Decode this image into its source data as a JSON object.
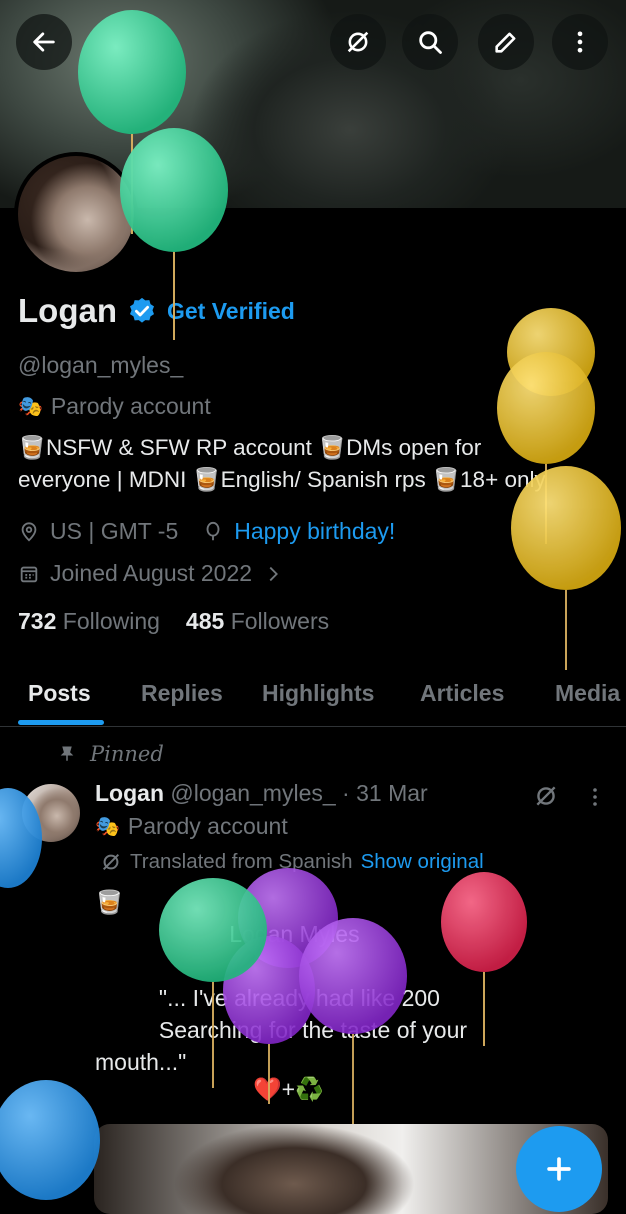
{
  "header": {
    "back_icon": "arrow-left-icon",
    "actions": [
      "grok-icon",
      "search-icon",
      "edit-icon",
      "more-vertical-icon"
    ]
  },
  "profile": {
    "name": "Logan",
    "verify_link": "Get Verified",
    "handle": "@logan_myles_",
    "parody_label": "Parody account",
    "bio_line1": "🥃NSFW & SFW RP account  🥃DMs open for",
    "bio_line2": "everyone | MDNI 🥃English/ Spanish rps 🥃18+ only",
    "location": "US | GMT -5",
    "birthday": "Happy birthday!",
    "joined": "Joined August 2022",
    "following_count": "732",
    "following_label": "Following",
    "followers_count": "485",
    "followers_label": "Followers"
  },
  "tabs": [
    "Posts",
    "Replies",
    "Highlights",
    "Articles",
    "Media"
  ],
  "post": {
    "pinned_label": "Pinned",
    "author": "Logan",
    "meta": "@logan_myles_ · 31 Mar",
    "parody_label": "Parody account",
    "translated_label": "Translated from Spanish",
    "show_original": "Show original",
    "body": "🥃\n                     Logan Myles\n\n          \"... I've already had like 200\n          Searching for the taste of your\nmouth...\"",
    "emoji_line": "❤️+♻️"
  },
  "colors": {
    "accent": "#1d9bf0",
    "balloon_green": "#3ed19a",
    "balloon_yellow": "#e6c02e",
    "balloon_purple": "#9b3fd9",
    "balloon_red": "#e0335a",
    "balloon_blue": "#2a8fe0"
  }
}
